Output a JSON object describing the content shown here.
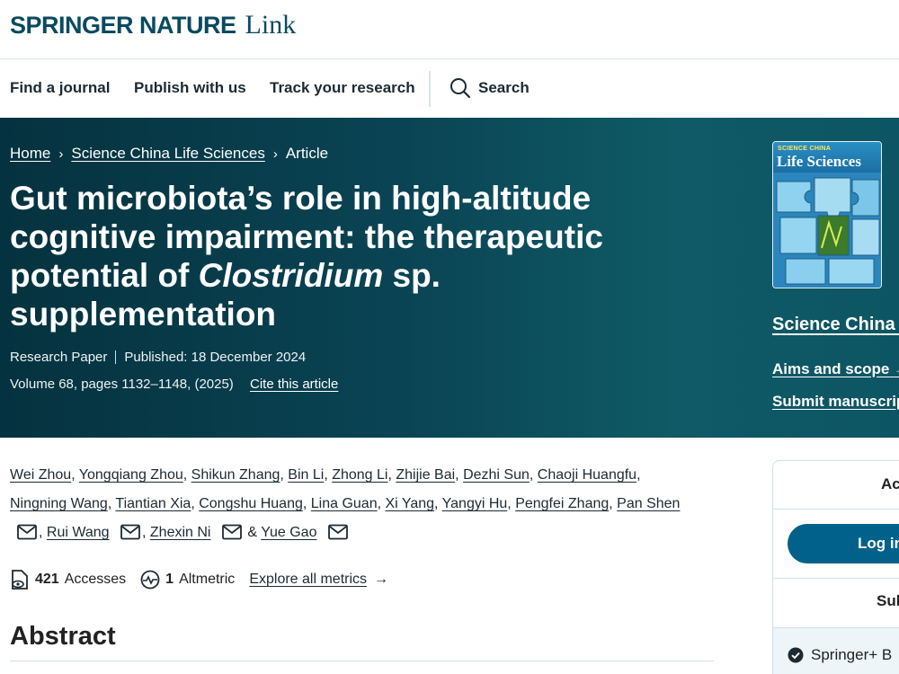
{
  "header": {
    "brand": "SPRINGER NATURE",
    "product": "Link"
  },
  "nav": {
    "items": [
      "Find a journal",
      "Publish with us",
      "Track your research"
    ],
    "search_label": "Search"
  },
  "breadcrumb": {
    "home": "Home",
    "journal": "Science China Life Sciences",
    "current": "Article",
    "separator": "›"
  },
  "article": {
    "title_part1": "Gut microbiota’s role in high-altitude cognitive impairment: the therapeutic potential of ",
    "title_italic": "Clostridium",
    "title_part2": " sp. supplementation",
    "type": "Research Paper",
    "published": "Published: 18 December 2024",
    "volume": "Volume 68, pages 1132–1148, (2025)",
    "cite_label": "Cite this article"
  },
  "journal_card": {
    "cover_kicker": "SCIENCE CHINA",
    "cover_title": "Life Sciences",
    "name": "Science China L",
    "aims_label": "Aims and scope",
    "submit_label": "Submit manuscript"
  },
  "authors": {
    "line1": [
      "Wei Zhou",
      "Yongqiang Zhou",
      "Shikun Zhang",
      "Bin Li",
      "Zhong Li",
      "Zhijie Bai",
      "Dezhi Sun",
      "Chaoji Huangfu"
    ],
    "line2": [
      "Ningning Wang",
      "Tiantian Xia",
      "Congshu Huang",
      "Lina Guan",
      "Xi Yang",
      "Yangyi Hu",
      "Pengfei Zhang",
      "Pan Shen"
    ],
    "corr": [
      "Rui Wang",
      "Zhexin Ni"
    ],
    "last": "Yue Gao",
    "and": "&"
  },
  "metrics": {
    "accesses_value": "421",
    "accesses_label": "Accesses",
    "altmetric_value": "1",
    "altmetric_label": "Altmetric",
    "explore_label": "Explore all metrics",
    "arrow": "→"
  },
  "abstract": {
    "heading": "Abstract"
  },
  "sidebar": {
    "access_heading": "Ac",
    "login_label": "Log in",
    "subscribe_heading": "Sul",
    "springer_plus": "Springer+ B"
  },
  "colors": {
    "brand_dark": "#0a4a60",
    "hero_start": "#05323f",
    "hero_end": "#0f5a66",
    "button": "#01618a"
  }
}
